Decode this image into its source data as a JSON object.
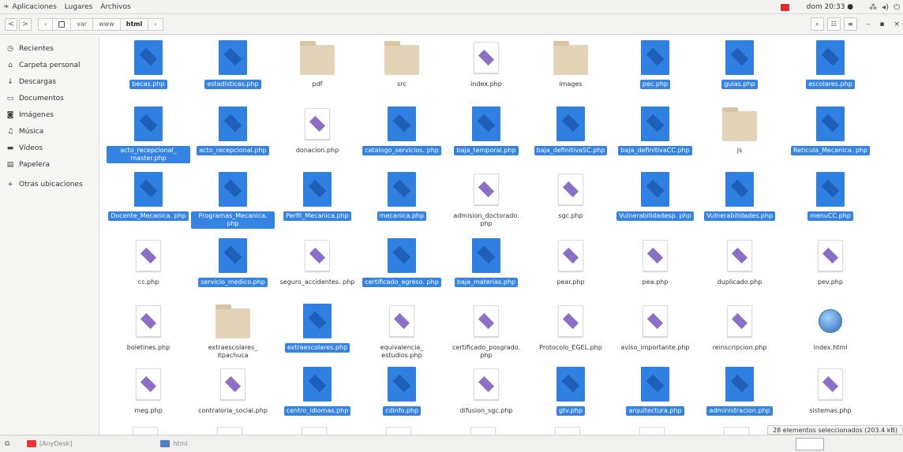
{
  "topbar": {
    "apps": "Aplicaciones",
    "places": "Lugares",
    "files": "Archivos",
    "clock": "dom 20:33 ●"
  },
  "toolbar": {
    "crumbs": [
      "var",
      "www",
      "html"
    ]
  },
  "sidebar": {
    "items": [
      {
        "label": "Recientes",
        "icon": "clock-icon"
      },
      {
        "label": "Carpeta personal",
        "icon": "home-icon"
      },
      {
        "label": "Descargas",
        "icon": "download-icon"
      },
      {
        "label": "Documentos",
        "icon": "document-icon"
      },
      {
        "label": "Imágenes",
        "icon": "camera-icon"
      },
      {
        "label": "Música",
        "icon": "music-icon"
      },
      {
        "label": "Vídeos",
        "icon": "video-icon"
      },
      {
        "label": "Papelera",
        "icon": "trash-icon"
      },
      {
        "label": "Otras ubicaciones",
        "icon": "plus-icon"
      }
    ]
  },
  "files": [
    {
      "name": "becas.php",
      "type": "php",
      "selected": true
    },
    {
      "name": "estadisticas.php",
      "type": "php",
      "selected": true
    },
    {
      "name": "pdf",
      "type": "folder",
      "selected": false
    },
    {
      "name": "src",
      "type": "folder",
      "selected": false
    },
    {
      "name": "index.php",
      "type": "php",
      "selected": false
    },
    {
      "name": "images",
      "type": "folder",
      "selected": false
    },
    {
      "name": "pec.php",
      "type": "php",
      "selected": true
    },
    {
      "name": "guias.php",
      "type": "php",
      "selected": true
    },
    {
      "name": "escolares.php",
      "type": "php",
      "selected": true
    },
    {
      "name": "acto_recepcional_ master.php",
      "type": "php",
      "selected": true
    },
    {
      "name": "acto_recepcional.php",
      "type": "php",
      "selected": true
    },
    {
      "name": "donacion.php",
      "type": "php",
      "selected": false
    },
    {
      "name": "catalogo_servicios. php",
      "type": "php",
      "selected": true
    },
    {
      "name": "baja_temporal.php",
      "type": "php",
      "selected": true
    },
    {
      "name": "baja_definitivaSC.php",
      "type": "php",
      "selected": true
    },
    {
      "name": "baja_definitivaCC.php",
      "type": "php",
      "selected": true
    },
    {
      "name": "js",
      "type": "folder",
      "selected": false
    },
    {
      "name": "Reticula_Mecanica. php",
      "type": "php",
      "selected": true
    },
    {
      "name": "Docente_Mecanica. php",
      "type": "php",
      "selected": true
    },
    {
      "name": "Programas_Mecanica. php",
      "type": "php",
      "selected": true
    },
    {
      "name": "Perfil_Mecanica.php",
      "type": "php",
      "selected": true
    },
    {
      "name": "mecanica.php",
      "type": "php",
      "selected": true
    },
    {
      "name": "admision_doctorado. php",
      "type": "php",
      "selected": false
    },
    {
      "name": "sgc.php",
      "type": "php",
      "selected": false
    },
    {
      "name": "Vulnerabilidadesp. php",
      "type": "php",
      "selected": true
    },
    {
      "name": "Vulnerabilidades.php",
      "type": "php",
      "selected": true
    },
    {
      "name": "menuCC.php",
      "type": "php",
      "selected": true
    },
    {
      "name": "cc.php",
      "type": "php",
      "selected": false
    },
    {
      "name": "servicio_medico.php",
      "type": "php",
      "selected": true
    },
    {
      "name": "seguro_accidentes. php",
      "type": "php",
      "selected": false
    },
    {
      "name": "certificado_egreso. php",
      "type": "php",
      "selected": true
    },
    {
      "name": "baja_materias.php",
      "type": "php",
      "selected": true
    },
    {
      "name": "pear.php",
      "type": "php",
      "selected": false
    },
    {
      "name": "pea.php",
      "type": "php",
      "selected": false
    },
    {
      "name": "duplicado.php",
      "type": "php",
      "selected": false
    },
    {
      "name": "pev.php",
      "type": "php",
      "selected": false
    },
    {
      "name": "boletines.php",
      "type": "php",
      "selected": false
    },
    {
      "name": "extraescolares_ itpachuca",
      "type": "folder",
      "selected": false
    },
    {
      "name": "extraescolares.php",
      "type": "php",
      "selected": true
    },
    {
      "name": "equivalencia_ estudios.php",
      "type": "php",
      "selected": false
    },
    {
      "name": "certificado_posgrado. php",
      "type": "php",
      "selected": false
    },
    {
      "name": "Protocolo_EGEL.php",
      "type": "php",
      "selected": false
    },
    {
      "name": "aviso_importante.php",
      "type": "php",
      "selected": false
    },
    {
      "name": "reinscripcion.php",
      "type": "php",
      "selected": false
    },
    {
      "name": "index.html",
      "type": "html",
      "selected": false
    },
    {
      "name": "meg.php",
      "type": "php",
      "selected": false
    },
    {
      "name": "contraloria_social.php",
      "type": "php",
      "selected": false
    },
    {
      "name": "centro_idiomas.php",
      "type": "php",
      "selected": true
    },
    {
      "name": "cdinfo.php",
      "type": "php",
      "selected": true
    },
    {
      "name": "difusion_sgc.php",
      "type": "php",
      "selected": false
    },
    {
      "name": "gtv.php",
      "type": "php",
      "selected": true
    },
    {
      "name": "arquitectura.php",
      "type": "php",
      "selected": true
    },
    {
      "name": "administracion.php",
      "type": "php",
      "selected": true
    },
    {
      "name": "sistemas.php",
      "type": "php",
      "selected": false
    }
  ],
  "status": "28 elementos seleccionados  (203.4 kB)",
  "taskbar": {
    "anydesk": "[AnyDesk]",
    "window": "html"
  }
}
